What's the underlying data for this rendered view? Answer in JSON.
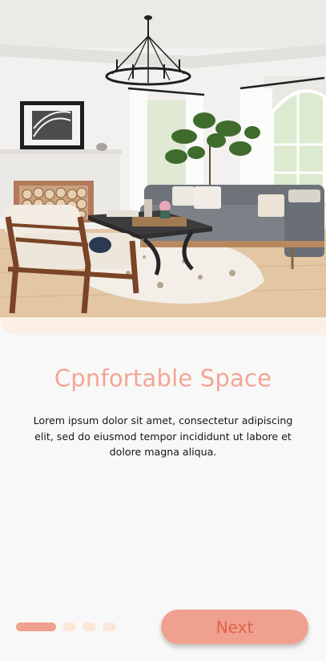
{
  "onboarding": {
    "hero_image": "living-room-photo",
    "title": "Cpnfortable Space",
    "description": "Lorem ipsum dolor sit amet, consectetur adipiscing elit, sed do eiusmod tempor incididunt ut labore et dolore magna aliqua.",
    "next_label": "Next",
    "page_indicator": {
      "total": 4,
      "active": 1
    }
  },
  "colors": {
    "accent": "#f0a08f",
    "title": "#f2a694",
    "button_text": "#e1634a",
    "dot_inactive": "#fbe6da",
    "hero_base": "#fbefe6"
  }
}
